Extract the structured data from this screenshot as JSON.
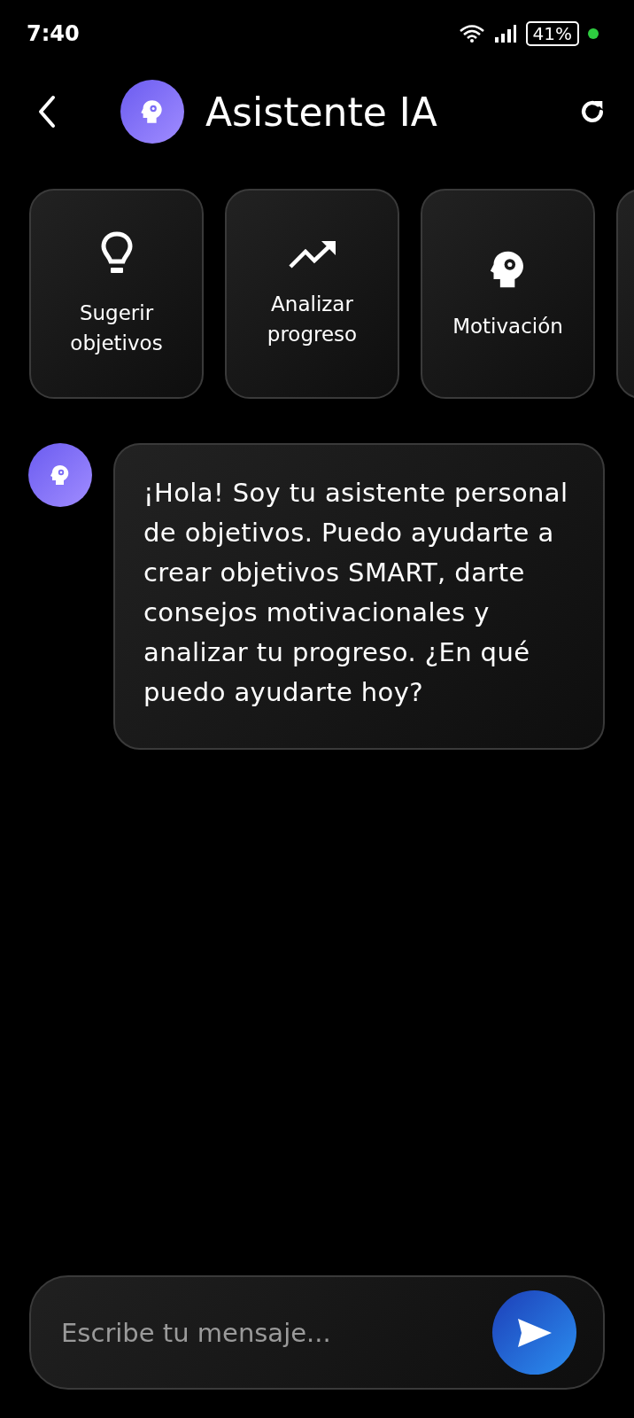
{
  "status_bar": {
    "time": "7:40",
    "battery": "41%"
  },
  "header": {
    "title": "Asistente IA"
  },
  "quick_actions": [
    {
      "kind": "bulb",
      "label": "Sugerir objetivos"
    },
    {
      "kind": "trend",
      "label": "Analizar progreso"
    },
    {
      "kind": "head",
      "label": "Motivación"
    }
  ],
  "messages": [
    {
      "kind": "assistant",
      "text": "¡Hola! Soy tu asistente personal de objetivos. Puedo ayudarte a crear objetivos SMART, darte consejos motivacionales y analizar tu progreso. ¿En qué puedo ayudarte hoy?"
    }
  ],
  "composer": {
    "placeholder": "Escribe tu mensaje..."
  }
}
